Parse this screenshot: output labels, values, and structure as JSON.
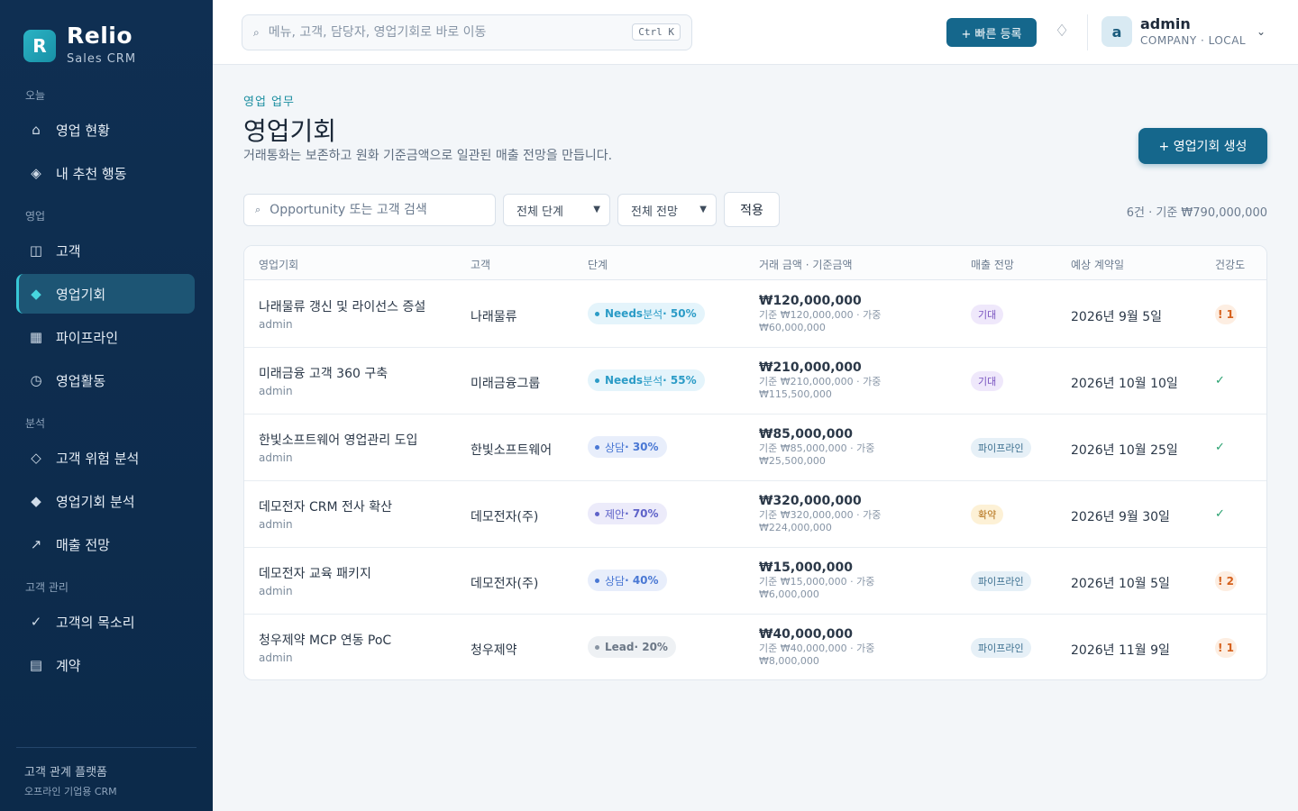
{
  "brand": {
    "logo": "R",
    "name": "Relio",
    "subtitle": "Sales CRM"
  },
  "sidebar": {
    "sections": [
      "오늘",
      "영업",
      "분석",
      "고객 관리"
    ],
    "items": [
      {
        "label": "영업 현황",
        "icon": "home-icon"
      },
      {
        "label": "내 추천 행동",
        "icon": "recommend-icon"
      },
      {
        "label": "고객",
        "icon": "customer-icon"
      },
      {
        "label": "영업기회",
        "icon": "opportunity-icon",
        "active": true
      },
      {
        "label": "파이프라인",
        "icon": "pipeline-icon"
      },
      {
        "label": "영업활동",
        "icon": "clock-icon"
      },
      {
        "label": "고객 위험 분석",
        "icon": "risk-icon"
      },
      {
        "label": "영업기회 분석",
        "icon": "analysis-icon"
      },
      {
        "label": "매출 전망",
        "icon": "trend-icon"
      },
      {
        "label": "고객의 목소리",
        "icon": "check-icon"
      },
      {
        "label": "계약",
        "icon": "contract-icon"
      }
    ],
    "footer": {
      "title": "고객 관계 플랫폼",
      "subtitle": "오프라인 기업용 CRM"
    }
  },
  "topbar": {
    "search_placeholder": "메뉴, 고객, 담당자, 영업기회로 바로 이동",
    "shortcut": "Ctrl K",
    "quick_button": "+ 빠른 등록",
    "user": {
      "initial": "a",
      "name": "admin",
      "sub": "COMPANY · LOCAL"
    }
  },
  "page": {
    "eyebrow": "영업 업무",
    "title": "영업기회",
    "description": "거래통화는 보존하고 원화 기준금액으로 일관된 매출 전망을 만듭니다.",
    "create_button": "+ 영업기회 생성"
  },
  "filters": {
    "search_placeholder": "Opportunity 또는 고객 검색",
    "stage_select": "전체 단계",
    "forecast_select": "전체 전망",
    "apply": "적용",
    "summary": "6건 · 기준 ₩790,000,000"
  },
  "table": {
    "columns": [
      "영업기회",
      "고객",
      "단계",
      "거래 금액 · 기준금액",
      "매출 전망",
      "예상 계약일",
      "건강도"
    ],
    "rows": [
      {
        "name": "나래물류 갱신 및 라이선스 증설",
        "owner": "admin",
        "customer": "나래물류",
        "stage_name": "Needs",
        "stage_sub": " 분석",
        "stage_pct": " · 50%",
        "stage_type": "needs",
        "amount": "₩120,000,000",
        "amount_sub": "기준 ₩120,000,000 · 가중 ₩60,000,000",
        "forecast": "기대",
        "forecast_type": "expect",
        "close_date": "2026년 9월 5일",
        "health": "! 1",
        "health_type": "warn"
      },
      {
        "name": "미래금융 고객 360 구축",
        "owner": "admin",
        "customer": "미래금융그룹",
        "stage_name": "Needs",
        "stage_sub": " 분석",
        "stage_pct": " · 55%",
        "stage_type": "needs",
        "amount": "₩210,000,000",
        "amount_sub": "기준 ₩210,000,000 · 가중 ₩115,500,000",
        "forecast": "기대",
        "forecast_type": "expect",
        "close_date": "2026년 10월 10일",
        "health": "✓",
        "health_type": "ok"
      },
      {
        "name": "한빛소프트웨어 영업관리 도입",
        "owner": "admin",
        "customer": "한빛소프트웨어",
        "stage_name": "",
        "stage_sub": "상담",
        "stage_pct": " · 30%",
        "stage_type": "consult",
        "amount": "₩85,000,000",
        "amount_sub": "기준 ₩85,000,000 · 가중 ₩25,500,000",
        "forecast": "파이프라인",
        "forecast_type": "pipe",
        "close_date": "2026년 10월 25일",
        "health": "✓",
        "health_type": "ok"
      },
      {
        "name": "데모전자 CRM 전사 확산",
        "owner": "admin",
        "customer": "데모전자(주)",
        "stage_name": "",
        "stage_sub": "제안",
        "stage_pct": " · 70%",
        "stage_type": "propose",
        "amount": "₩320,000,000",
        "amount_sub": "기준 ₩320,000,000 · 가중 ₩224,000,000",
        "forecast": "확약",
        "forecast_type": "commit",
        "close_date": "2026년 9월 30일",
        "health": "✓",
        "health_type": "ok"
      },
      {
        "name": "데모전자 교육 패키지",
        "owner": "admin",
        "customer": "데모전자(주)",
        "stage_name": "",
        "stage_sub": "상담",
        "stage_pct": " · 40%",
        "stage_type": "consult",
        "amount": "₩15,000,000",
        "amount_sub": "기준 ₩15,000,000 · 가중 ₩6,000,000",
        "forecast": "파이프라인",
        "forecast_type": "pipe",
        "close_date": "2026년 10월 5일",
        "health": "! 2",
        "health_type": "warn"
      },
      {
        "name": "청우제약 MCP 연동 PoC",
        "owner": "admin",
        "customer": "청우제약",
        "stage_name": "Lead",
        "stage_sub": "",
        "stage_pct": " · 20%",
        "stage_type": "lead",
        "amount": "₩40,000,000",
        "amount_sub": "기준 ₩40,000,000 · 가중 ₩8,000,000",
        "forecast": "파이프라인",
        "forecast_type": "pipe",
        "close_date": "2026년 11월 9일",
        "health": "! 1",
        "health_type": "warn"
      }
    ]
  }
}
